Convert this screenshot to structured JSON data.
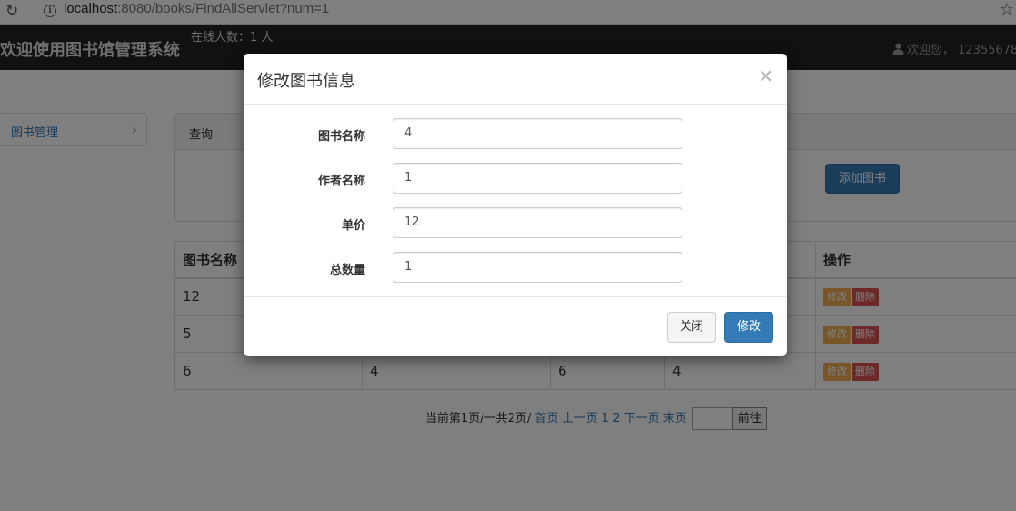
{
  "browser": {
    "url_host": "localhost",
    "url_path": ":8080/books/FindAllServlet?num=1"
  },
  "navbar": {
    "brand": "欢迎使用图书馆管理系统",
    "online": "在线人数：1 人",
    "user": "欢迎您， 12355678"
  },
  "sidebar": {
    "items": [
      {
        "label": "图书管理"
      }
    ]
  },
  "panel": {
    "title": "查询",
    "add_label": "添加图书"
  },
  "table": {
    "headers": [
      "图书名称",
      "",
      "",
      "",
      "操作"
    ],
    "rows": [
      {
        "cells": [
          "12",
          "",
          "",
          ""
        ]
      },
      {
        "cells": [
          "5",
          "",
          "",
          ""
        ]
      },
      {
        "cells": [
          "6",
          "4",
          "6",
          "4"
        ]
      }
    ],
    "edit_label": "修改",
    "delete_label": "删除"
  },
  "pager": {
    "status": "当前第1页/一共2页/",
    "first": "首页",
    "prev": "上一页",
    "page1": "1",
    "page2": "2",
    "next": "下一页",
    "last": "末页",
    "go": "前往"
  },
  "modal": {
    "title": "修改图书信息",
    "close_x": "×",
    "fields": [
      {
        "label": "图书名称",
        "value": "4"
      },
      {
        "label": "作者名称",
        "value": "1"
      },
      {
        "label": "单价",
        "value": "12"
      },
      {
        "label": "总数量",
        "value": "1"
      }
    ],
    "close_label": "关闭",
    "submit_label": "修改"
  }
}
